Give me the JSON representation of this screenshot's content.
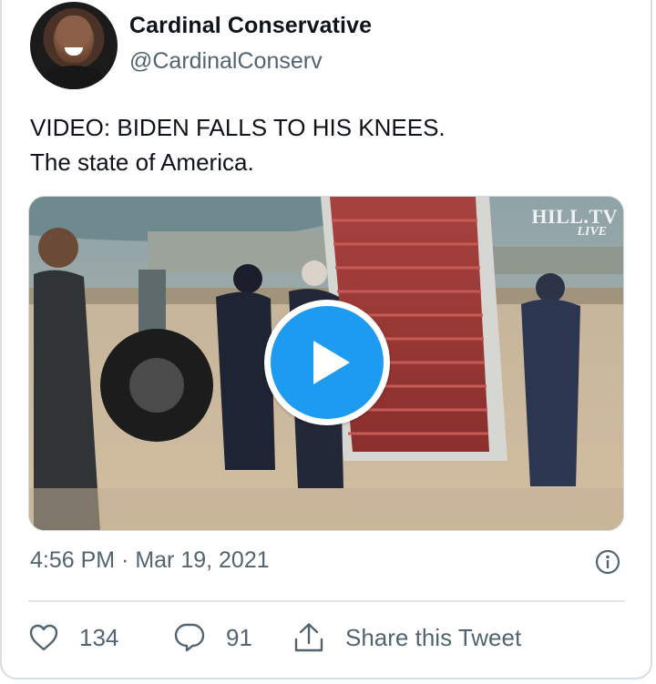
{
  "author": {
    "name": "Cardinal Conservative",
    "handle": "@CardinalConserv"
  },
  "tweet": {
    "text_lines": [
      "VIDEO: BIDEN FALLS TO HIS KNEES.",
      "The state of America."
    ],
    "timestamp": "4:56 PM · Mar 19, 2021"
  },
  "media": {
    "watermark_line1": "HILL.TV",
    "watermark_line2": "LIVE",
    "play_button_color": "#1d9bf0"
  },
  "actions": {
    "like_count": "134",
    "reply_count": "91",
    "share_label": "Share this Tweet"
  },
  "icons": {
    "like": "heart-icon",
    "reply": "speech-bubble-icon",
    "share": "share-upload-icon",
    "info": "info-icon",
    "play": "play-icon"
  }
}
